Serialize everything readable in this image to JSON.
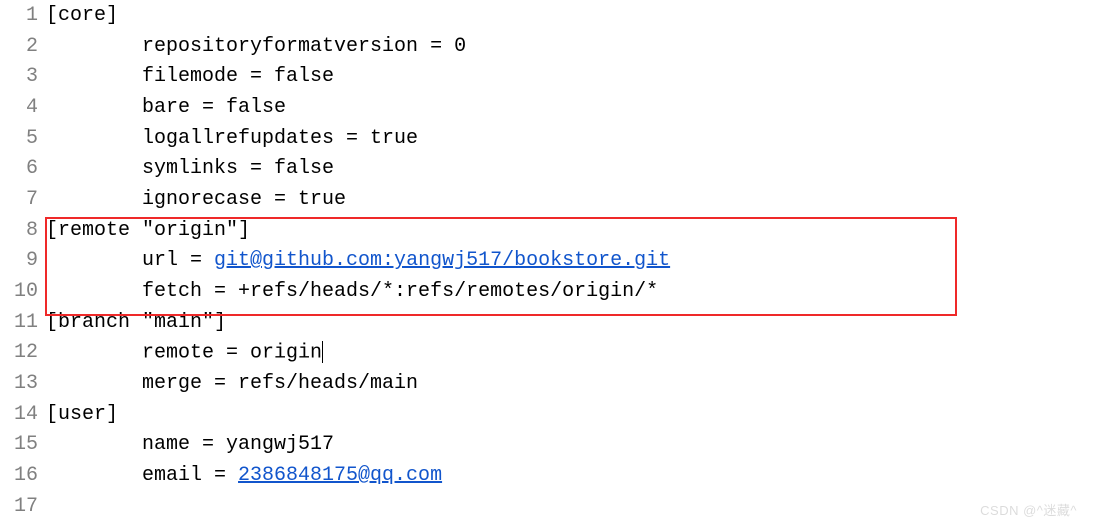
{
  "lines": [
    {
      "num": "1",
      "text": "[core]"
    },
    {
      "num": "2",
      "text": "        repositoryformatversion = 0"
    },
    {
      "num": "3",
      "text": "        filemode = false"
    },
    {
      "num": "4",
      "text": "        bare = false"
    },
    {
      "num": "5",
      "text": "        logallrefupdates = true"
    },
    {
      "num": "6",
      "text": "        symlinks = false"
    },
    {
      "num": "7",
      "text": "        ignorecase = true"
    },
    {
      "num": "8",
      "text": "[remote \"origin\"]"
    },
    {
      "num": "9",
      "pre": "        url = ",
      "link": "git@github.com:yangwj517/bookstore.git"
    },
    {
      "num": "10",
      "text": "        fetch = +refs/heads/*:refs/remotes/origin/*"
    },
    {
      "num": "11",
      "text": "[branch \"main\"]"
    },
    {
      "num": "12",
      "text": "        remote = origin",
      "cursor": true
    },
    {
      "num": "13",
      "text": "        merge = refs/heads/main"
    },
    {
      "num": "14",
      "text": "[user]"
    },
    {
      "num": "15",
      "text": "        name = yangwj517"
    },
    {
      "num": "16",
      "pre": "        email = ",
      "link": "2386848175@qq.com"
    },
    {
      "num": "17",
      "text": ""
    }
  ],
  "watermark": "CSDN @^迷藏^"
}
